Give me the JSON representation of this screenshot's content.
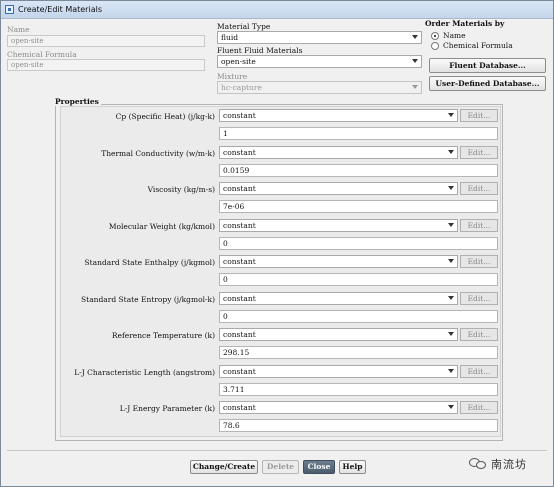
{
  "window": {
    "title": "Create/Edit Materials"
  },
  "left": {
    "name_label": "Name",
    "name_value": "open-site",
    "formula_label": "Chemical Formula",
    "formula_value": "open-site"
  },
  "material_type": {
    "label": "Material Type",
    "value": "fluid"
  },
  "fluent_fluid": {
    "label": "Fluent Fluid Materials",
    "value": "open-site"
  },
  "mixture": {
    "label": "Mixture",
    "value": "hc-capture"
  },
  "order": {
    "title": "Order Materials by",
    "options": [
      {
        "label": "Name",
        "selected": true
      },
      {
        "label": "Chemical Formula",
        "selected": false
      }
    ]
  },
  "db_buttons": {
    "fluent": "Fluent Database...",
    "user": "User-Defined Database..."
  },
  "properties": {
    "title": "Properties",
    "edit_label": "Edit...",
    "items": [
      {
        "label": "Cp (Specific Heat) (j/kg-k)",
        "method": "constant",
        "value": "1"
      },
      {
        "label": "Thermal Conductivity (w/m-k)",
        "method": "constant",
        "value": "0.0159"
      },
      {
        "label": "Viscosity (kg/m-s)",
        "method": "constant",
        "value": "7e-06"
      },
      {
        "label": "Molecular Weight (kg/kmol)",
        "method": "constant",
        "value": "0"
      },
      {
        "label": "Standard State Enthalpy (j/kgmol)",
        "method": "constant",
        "value": "0"
      },
      {
        "label": "Standard State Entropy (j/kgmol-k)",
        "method": "constant",
        "value": "0"
      },
      {
        "label": "Reference Temperature (k)",
        "method": "constant",
        "value": "298.15"
      },
      {
        "label": "L-J Characteristic Length (angstrom)",
        "method": "constant",
        "value": "3.711"
      },
      {
        "label": "L-J Energy Parameter (k)",
        "method": "constant",
        "value": "78.6"
      }
    ]
  },
  "footer": {
    "change_create": "Change/Create",
    "delete": "Delete",
    "close": "Close",
    "help": "Help"
  },
  "watermark": {
    "text": "南流坊",
    "icon": "wechat-icon"
  }
}
